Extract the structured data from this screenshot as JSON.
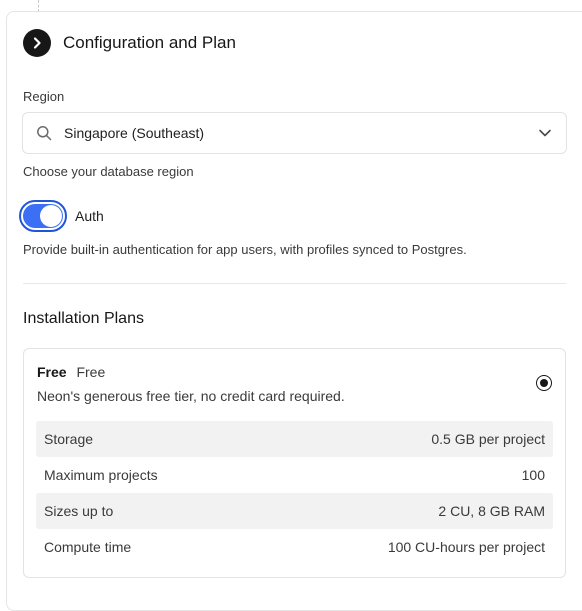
{
  "header": {
    "title": "Configuration and Plan",
    "icon": "chevron-right-icon"
  },
  "region": {
    "label": "Region",
    "value": "Singapore (Southeast)",
    "hint": "Choose your database region"
  },
  "auth": {
    "label": "Auth",
    "enabled": true,
    "description": "Provide built-in authentication for app users, with profiles synced to Postgres."
  },
  "plans": {
    "title": "Installation Plans",
    "items": [
      {
        "name": "Free",
        "price": "Free",
        "description": "Neon's generous free tier, no credit card required.",
        "selected": true,
        "features": [
          {
            "label": "Storage",
            "value": "0.5 GB per project"
          },
          {
            "label": "Maximum projects",
            "value": "100"
          },
          {
            "label": "Sizes up to",
            "value": "2 CU, 8 GB RAM"
          },
          {
            "label": "Compute time",
            "value": "100 CU-hours per project"
          }
        ]
      }
    ]
  },
  "colors": {
    "toggle_on": "#3b6ff5",
    "toggle_ring": "#1f56d8",
    "text": "#171717"
  }
}
